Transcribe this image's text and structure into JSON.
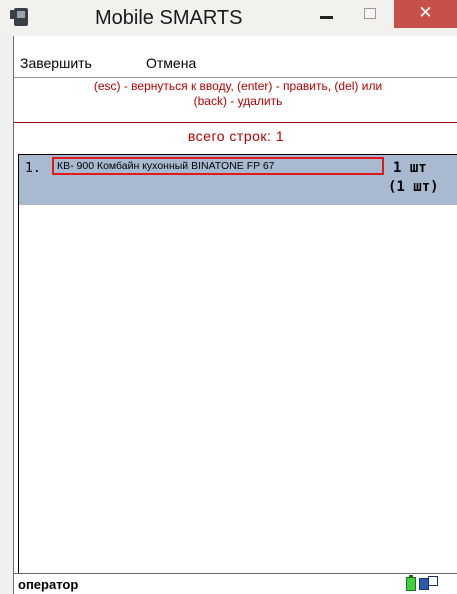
{
  "window": {
    "title": "Mobile SMARTS",
    "close_glyph": "✕",
    "close_color": "#c7504a"
  },
  "menu": {
    "finish": "Завершить",
    "cancel": "Отмена"
  },
  "hint": {
    "line1": "(esc) - вернуться к вводу, (enter) - править, (del) или",
    "line2": "(back) - удалить",
    "color": "#b40000"
  },
  "summary": {
    "total": "всего строк: 1"
  },
  "list": {
    "selection_color": "#a8bacf",
    "rows": [
      {
        "num": "1.",
        "name": "КВ- 900 Комбайн кухонный BINATONE FP 67",
        "qty": "1 шт",
        "qty2": "(1 шт)"
      }
    ]
  },
  "status": {
    "user": "оператор"
  },
  "icons": {
    "app": "app-icon",
    "battery": "battery-icon",
    "network": "network-icon"
  }
}
